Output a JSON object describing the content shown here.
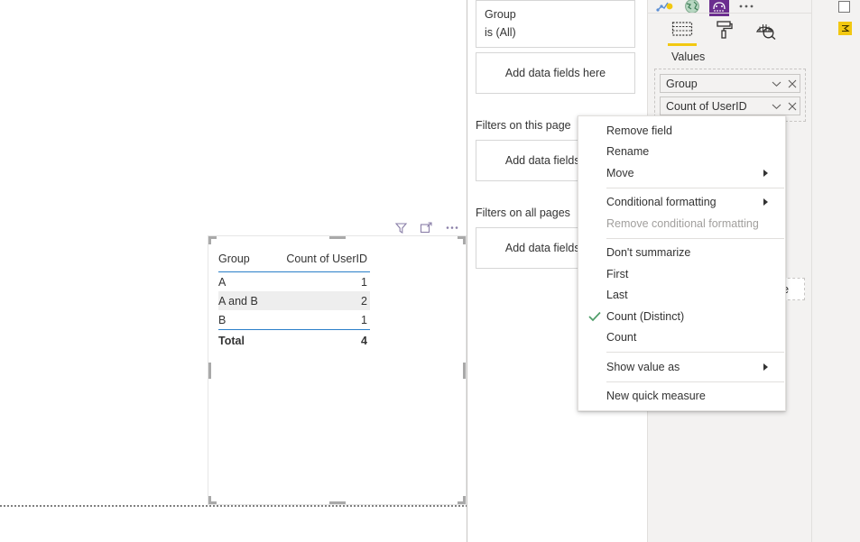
{
  "canvas": {
    "visual": {
      "header_icons": [
        {
          "name": "filter-icon",
          "label": "Filters"
        },
        {
          "name": "focus-mode-icon",
          "label": "Focus mode"
        },
        {
          "name": "more-options-icon",
          "label": "More options"
        }
      ],
      "table": {
        "columns": [
          "Group",
          "Count of UserID"
        ],
        "rows": [
          {
            "group": "A",
            "count": "1"
          },
          {
            "group": "A and B",
            "count": "2"
          },
          {
            "group": "B",
            "count": "1"
          }
        ],
        "total": {
          "group": "Total",
          "count": "4"
        }
      }
    }
  },
  "filters_pane": {
    "visual_filter_card": {
      "field": "Group",
      "condition": "is (All)"
    },
    "visual_drop_zone": "Add data fields here",
    "page_section_title": "Filters on this page",
    "page_drop_zone": "Add data fields here",
    "all_pages_section_title": "Filters on all pages",
    "all_pages_drop_zone": "Add data fields here",
    "hidden_drop_zone_fragment": "re"
  },
  "visualizations_pane": {
    "gallery": [
      {
        "name": "key-influencers-visual-icon",
        "selected": false
      },
      {
        "name": "arcgis-map-visual-icon",
        "selected": false
      },
      {
        "name": "python-visual-icon",
        "selected": true
      },
      {
        "name": "get-more-visuals-icon",
        "selected": false
      }
    ],
    "tabs": [
      {
        "name": "fields-tab",
        "label": "Fields",
        "selected": true
      },
      {
        "name": "format-tab",
        "label": "Format",
        "selected": false
      },
      {
        "name": "analytics-tab",
        "label": "Analytics",
        "selected": false
      }
    ],
    "well_title": "Values",
    "fields": [
      {
        "label": "Group"
      },
      {
        "label": "Count of UserID"
      }
    ]
  },
  "fields_pane": {
    "checkbox_checked": false,
    "measure_icon": "sigma-measure-icon"
  },
  "context_menu": {
    "items": [
      {
        "label": "Remove field",
        "type": "item",
        "checked": false,
        "submenu": false,
        "disabled": false
      },
      {
        "label": "Rename",
        "type": "item",
        "checked": false,
        "submenu": false,
        "disabled": false
      },
      {
        "label": "Move",
        "type": "item",
        "checked": false,
        "submenu": true,
        "disabled": false
      },
      {
        "type": "separator"
      },
      {
        "label": "Conditional formatting",
        "type": "item",
        "checked": false,
        "submenu": true,
        "disabled": false
      },
      {
        "label": "Remove conditional formatting",
        "type": "item",
        "checked": false,
        "submenu": false,
        "disabled": true
      },
      {
        "type": "separator"
      },
      {
        "label": "Don't summarize",
        "type": "item",
        "checked": false,
        "submenu": false,
        "disabled": false
      },
      {
        "label": "First",
        "type": "item",
        "checked": false,
        "submenu": false,
        "disabled": false
      },
      {
        "label": "Last",
        "type": "item",
        "checked": false,
        "submenu": false,
        "disabled": false
      },
      {
        "label": "Count (Distinct)",
        "type": "item",
        "checked": true,
        "submenu": false,
        "disabled": false
      },
      {
        "label": "Count",
        "type": "item",
        "checked": false,
        "submenu": false,
        "disabled": false
      },
      {
        "type": "separator"
      },
      {
        "label": "Show value as",
        "type": "item",
        "checked": false,
        "submenu": true,
        "disabled": false
      },
      {
        "type": "separator"
      },
      {
        "label": "New quick measure",
        "type": "item",
        "checked": false,
        "submenu": false,
        "disabled": false
      }
    ]
  },
  "colors": {
    "accent_yellow": "#f2c811",
    "table_rule_blue": "#2a7fc9",
    "check_green": "#4f9d69",
    "pane_bg": "#f3f2f1",
    "purple_selected": "#6b2d8f"
  }
}
